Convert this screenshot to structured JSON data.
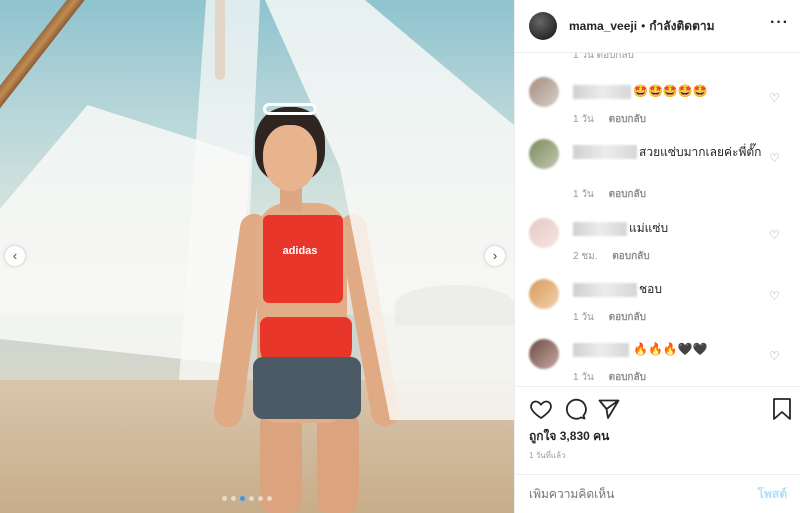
{
  "post": {
    "username": "mama_veeji",
    "separator": "•",
    "follow_status": "กำลังติดตาม",
    "more_label": "···",
    "media": {
      "brand_text": "adidas",
      "carousel_dots": 6,
      "active_dot": 2,
      "prev_icon": "chevron-left-icon",
      "next_icon": "chevron-right-icon"
    }
  },
  "comments": {
    "partial_top_meta": "1 วัน   ตอบกลับ",
    "items": [
      {
        "text": "🤩🤩🤩🤩🤩",
        "time": "1 วัน",
        "reply": "ตอบกลับ"
      },
      {
        "text": "สวยแซ่บมากเลยค่ะพี่ตั๊ก",
        "time": "1 วัน",
        "reply": "ตอบกลับ"
      },
      {
        "text": "แม่แซ่บ",
        "time": "2 ชม.",
        "reply": "ตอบกลับ"
      },
      {
        "text": "ชอบ",
        "time": "1 วัน",
        "reply": "ตอบกลับ"
      },
      {
        "text": "🔥🔥🔥🖤🖤",
        "time": "1 วัน",
        "reply": "ตอบกลับ"
      }
    ]
  },
  "actions": {
    "likes": "ถูกใจ 3,830 คน",
    "timestamp": "1 วันที่แล้ว",
    "icons": [
      "heart-icon",
      "comment-icon",
      "share-icon",
      "bookmark-icon"
    ]
  },
  "add_comment": {
    "placeholder": "เพิ่มความคิดเห็น",
    "post_label": "โพสต์"
  }
}
